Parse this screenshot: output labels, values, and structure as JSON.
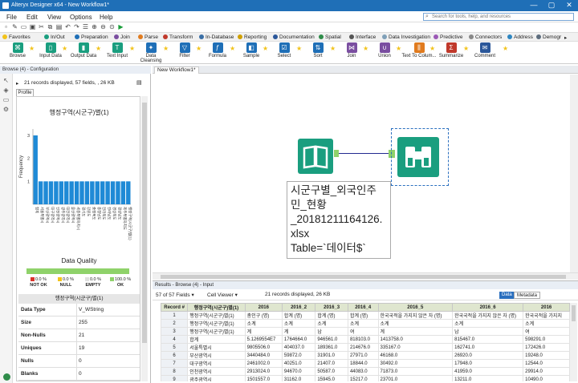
{
  "window": {
    "title": "Alteryx Designer x64 - New Workflow1*",
    "controls": [
      "—",
      "▢",
      "✕"
    ]
  },
  "menu": {
    "items": [
      "File",
      "Edit",
      "View",
      "Options",
      "Help"
    ],
    "search_placeholder": "Search for tools, help, and resources"
  },
  "categories": [
    {
      "label": "Favorites",
      "color": "#f2c31b"
    },
    {
      "label": "In/Out",
      "color": "#1a9e7f"
    },
    {
      "label": "Preparation",
      "color": "#1f6fb7"
    },
    {
      "label": "Join",
      "color": "#7a4ea0"
    },
    {
      "label": "Parse",
      "color": "#e07b1f"
    },
    {
      "label": "Transform",
      "color": "#c0392b"
    },
    {
      "label": "In-Database",
      "color": "#3a6ea5"
    },
    {
      "label": "Reporting",
      "color": "#d0a000"
    },
    {
      "label": "Documentation",
      "color": "#2b579a"
    },
    {
      "label": "Spatial",
      "color": "#2f8c4a"
    },
    {
      "label": "Interface",
      "color": "#555555"
    },
    {
      "label": "Data Investigation",
      "color": "#7fa0b8"
    },
    {
      "label": "Predictive",
      "color": "#9b59b6"
    },
    {
      "label": "Connectors",
      "color": "#888888"
    },
    {
      "label": "Address",
      "color": "#2e86c1"
    },
    {
      "label": "Demogr",
      "color": "#5d6d7e"
    }
  ],
  "tools": [
    {
      "label": "Browse",
      "color": "#1a9e7f",
      "icon": "binoculars-icon"
    },
    {
      "label": "Input Data",
      "color": "#1a9e7f",
      "icon": "book-icon"
    },
    {
      "label": "Output Data",
      "color": "#1a9e7f",
      "icon": "book-out-icon"
    },
    {
      "label": "Text Input",
      "color": "#1a9e7f",
      "icon": "text-icon"
    },
    {
      "label": "Data Cleansing",
      "color": "#1f6fb7",
      "icon": "brush-icon"
    },
    {
      "label": "Filter",
      "color": "#1f6fb7",
      "icon": "filter-icon"
    },
    {
      "label": "Formula",
      "color": "#1f6fb7",
      "icon": "formula-icon"
    },
    {
      "label": "Sample",
      "color": "#1f6fb7",
      "icon": "sample-icon"
    },
    {
      "label": "Select",
      "color": "#1f6fb7",
      "icon": "select-icon"
    },
    {
      "label": "Sort",
      "color": "#1f6fb7",
      "icon": "sort-icon"
    },
    {
      "label": "Join",
      "color": "#7a4ea0",
      "icon": "join-icon"
    },
    {
      "label": "Union",
      "color": "#7a4ea0",
      "icon": "union-icon"
    },
    {
      "label": "Text To Colum...",
      "color": "#e07b1f",
      "icon": "text-to-columns-icon"
    },
    {
      "label": "Summarize",
      "color": "#c0392b",
      "icon": "summarize-icon"
    },
    {
      "label": "Comment",
      "color": "#2b579a",
      "icon": "comment-icon"
    }
  ],
  "config_panel": {
    "header": "Browse (4) - Configuration",
    "records_info": "21 records displayed, 57 fields, , 26 KB",
    "profile_tab": "Profile",
    "chart_title": "행정구역(시군구)별(1)",
    "data_quality_title": "Data Quality",
    "dq_legend": [
      {
        "pct": "0.0 %",
        "label": "NOT OK",
        "color": "#d9342b"
      },
      {
        "pct": "0.0 %",
        "label": "NULL",
        "color": "#f2c31b"
      },
      {
        "pct": "0.0 %",
        "label": "EMPTY",
        "color": "#f0f0f0"
      },
      {
        "pct": "100.0 %",
        "label": "OK",
        "color": "#8fd26a"
      }
    ],
    "stats_title": "행정구역(시군구)별(1)",
    "stats": [
      {
        "key": "Data Type",
        "value": "V_WString"
      },
      {
        "key": "Size",
        "value": "255"
      },
      {
        "key": "Non-Nulls",
        "value": "21"
      },
      {
        "key": "Uniques",
        "value": "19"
      },
      {
        "key": "Nulls",
        "value": "0"
      },
      {
        "key": "Blanks",
        "value": "0"
      }
    ]
  },
  "chart_data": {
    "type": "bar",
    "ylabel": "Frequency",
    "ylim": [
      0,
      3
    ],
    "yticks": [
      1,
      2,
      3
    ],
    "categories": [
      "합계",
      "서울특별시",
      "부산광역시",
      "대구광역시",
      "인천광역시",
      "광주광역시",
      "대전광역시",
      "울산광역시",
      "세종특별자치시",
      "경기도",
      "강원도",
      "충청북도",
      "충청남도",
      "전라북도",
      "전라남도",
      "경상북도",
      "경상남도",
      "제주특별자치도",
      "행정구역(시군구)별(1)"
    ],
    "values": [
      3,
      1,
      1,
      1,
      1,
      1,
      1,
      1,
      1,
      1,
      1,
      1,
      1,
      1,
      1,
      1,
      1,
      1,
      1
    ],
    "bar_color": "#1f8ad6"
  },
  "canvas": {
    "tab": "New Workflow1*",
    "annotation": "시군구별_외국인주\n민_현황\n_20181211164126.\nxlsx\nTable=`데이터$`"
  },
  "results": {
    "header": "Results - Browse (4) - Input",
    "fields_selector": "57 of 57 Fields",
    "cell_viewer": "Cell Viewer",
    "records_info": "21 records displayed, 26 KB",
    "data_button": "Data",
    "metadata_button": "Metadata",
    "columns": [
      "Record #",
      "행정구역(시군구)별(1)",
      "2016",
      "2016_2",
      "2016_3",
      "2016_4",
      "2016_5",
      "2016_6",
      "2016"
    ],
    "rows": [
      [
        "1",
        "행정구역(시군구)별(1)",
        "총인구 (명)",
        "합계 (명)",
        "합계 (명)",
        "합계 (명)",
        "한국국적을 가지지 않은 자 (명)",
        "한국국적을 가지지 않은 자 (명)",
        "한국국적을 가지지"
      ],
      [
        "2",
        "행정구역(시군구)별(1)",
        "소계",
        "소계",
        "소계",
        "소계",
        "소계",
        "소계",
        "소계"
      ],
      [
        "3",
        "행정구역(시군구)별(1)",
        "계",
        "계",
        "남",
        "여",
        "계",
        "남",
        "여"
      ],
      [
        "4",
        "합계",
        "5.1269554E7",
        "1764664.0",
        "946561.0",
        "818103.0",
        "1413758.0",
        "815467.0",
        "598291.0"
      ],
      [
        "5",
        "서울특별시",
        "9805506.0",
        "404037.0",
        "189361.0",
        "214676.0",
        "335167.0",
        "162741.0",
        "172426.0"
      ],
      [
        "6",
        "부산광역시",
        "3440484.0",
        "59872.0",
        "31901.0",
        "27971.0",
        "46168.0",
        "26920.0",
        "19248.0"
      ],
      [
        "7",
        "대구광역시",
        "2461002.0",
        "40251.0",
        "21407.0",
        "18844.0",
        "30492.0",
        "17948.0",
        "12544.0"
      ],
      [
        "8",
        "인천광역시",
        "2913024.0",
        "94670.0",
        "50587.0",
        "44083.0",
        "71873.0",
        "41959.0",
        "29914.0"
      ],
      [
        "9",
        "광주광역시",
        "1501557.0",
        "31162.0",
        "15945.0",
        "15217.0",
        "23701.0",
        "13211.0",
        "10490.0"
      ]
    ]
  }
}
